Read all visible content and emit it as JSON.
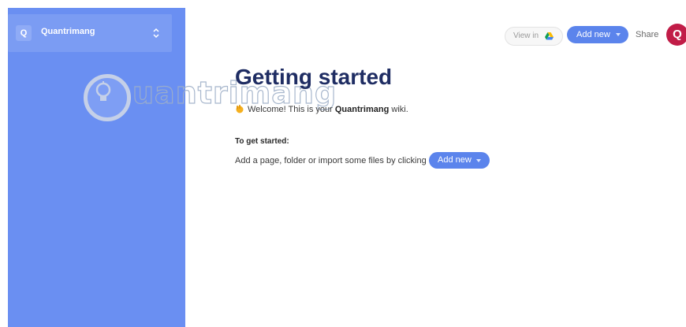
{
  "sidebar": {
    "workspace": {
      "initial": "Q",
      "name": "Quantrimang",
      "icon": "chevron-updown-icon"
    }
  },
  "watermark": {
    "text": "uantrimang",
    "icon": "lightbulb-icon"
  },
  "header": {
    "view_in_label": "View in",
    "view_in_icon": "google-drive-icon",
    "add_new_label": "Add new",
    "share_label": "Share",
    "user_initial": "Q"
  },
  "main": {
    "title": "Getting started",
    "welcome_prefix": "Welcome! This is your ",
    "welcome_bold": "Quantrimang",
    "welcome_suffix": " wiki.",
    "welcome_icon": "waving-hand-icon",
    "get_started": "To get started:",
    "instruction": "Add a page, folder or import some files by clicking",
    "add_new_label": "Add new"
  },
  "colors": {
    "sidebar": "#6a8ff2",
    "accent": "#5b84ec",
    "title": "#1f2d63",
    "avatar": "#c11c47"
  }
}
